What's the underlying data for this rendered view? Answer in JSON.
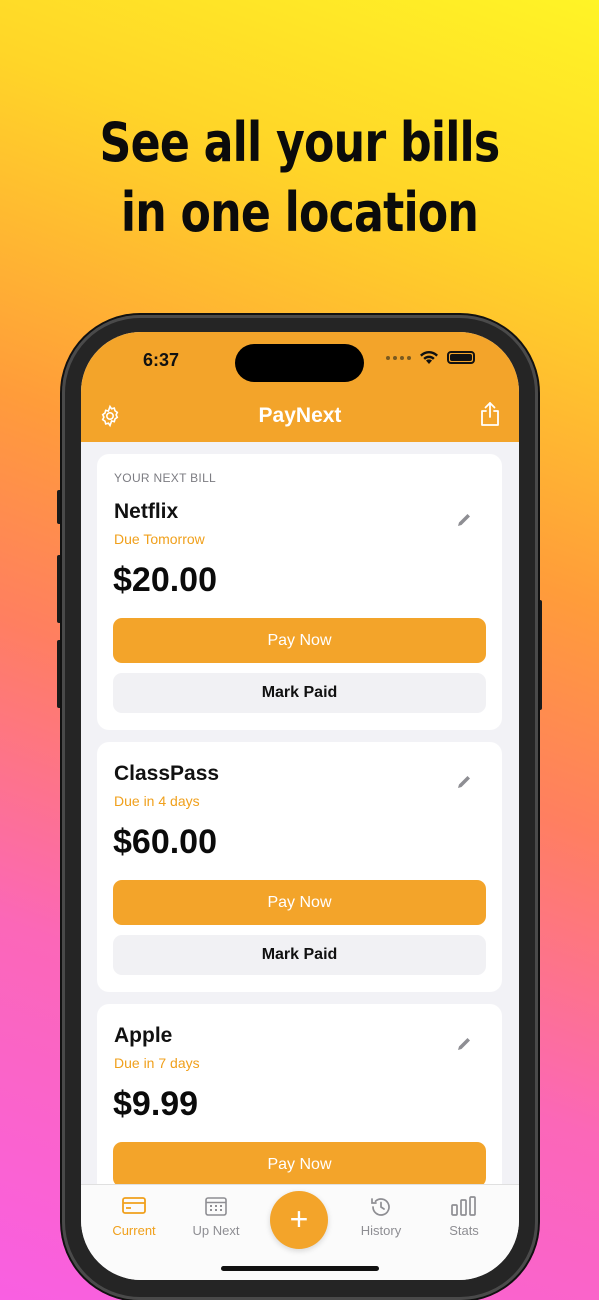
{
  "promo": {
    "line1": "See all your bills",
    "line2": "in one location"
  },
  "status_bar": {
    "time": "6:37"
  },
  "navbar": {
    "title": "PayNext",
    "left_icon": "gear-icon",
    "right_icon": "share-icon"
  },
  "next_bill_label": "YOUR NEXT BILL",
  "bills": [
    {
      "name": "Netflix",
      "due": "Due Tomorrow",
      "amount": "$20.00",
      "pay_label": "Pay Now",
      "mark_label": "Mark Paid"
    },
    {
      "name": "ClassPass",
      "due": "Due in 4 days",
      "amount": "$60.00",
      "pay_label": "Pay Now",
      "mark_label": "Mark Paid"
    },
    {
      "name": "Apple",
      "due": "Due in 7 days",
      "amount": "$9.99",
      "pay_label": "Pay Now"
    }
  ],
  "tabbar": {
    "tabs": [
      {
        "label": "Current",
        "icon": "card-icon",
        "active": true
      },
      {
        "label": "Up Next",
        "icon": "calendar-icon",
        "active": false
      },
      {
        "label": "History",
        "icon": "history-icon",
        "active": false
      },
      {
        "label": "Stats",
        "icon": "stats-icon",
        "active": false
      }
    ],
    "add_label": "+"
  },
  "colors": {
    "accent": "#f3a42a",
    "due_text": "#f0a01c",
    "background": "#f2f2f6"
  }
}
